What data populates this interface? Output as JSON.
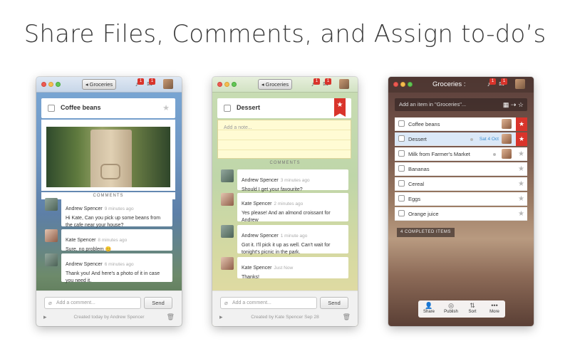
{
  "headline": "Share Files, Comments, and Assign to-do’s",
  "windows": [
    {
      "back_label": "◂ Groceries",
      "badges": [
        "1",
        "1"
      ],
      "detail": {
        "title": "Coffee beans"
      },
      "comments_label": "COMMENTS",
      "comments": [
        {
          "name": "Andrew Spencer",
          "time": "9 minutes ago",
          "text": "Hi Kate, Can you pick up some beans from the cafe near your house?"
        },
        {
          "name": "Kate Spencer",
          "time": "8 minutes ago",
          "text": "Sure, no problem 😊"
        },
        {
          "name": "Andrew Spencer",
          "time": "6 minutes ago",
          "text": "Thank you! And here's a photo of it in case you need it."
        }
      ],
      "add_comment_placeholder": "Add a comment...",
      "send_label": "Send",
      "created_text": "Created today by Andrew Spencer"
    },
    {
      "back_label": "◂ Groceries",
      "badges": [
        "1",
        "1"
      ],
      "detail": {
        "title": "Dessert",
        "note_placeholder": "Add a note..."
      },
      "comments_label": "COMMENTS",
      "comments": [
        {
          "name": "Andrew Spencer",
          "time": "3 minutes ago",
          "text": "Should I get your favourite?"
        },
        {
          "name": "Kate Spencer",
          "time": "2 minutes ago",
          "text": "Yes please! And an almond croissant for Andrew"
        },
        {
          "name": "Andrew Spencer",
          "time": "1 minute ago",
          "text": "Got it. I'll pick it up as well. Can't wait for tonight's picnic in the park."
        },
        {
          "name": "Kate Spencer",
          "time": "Just Now",
          "text": "Thanks!"
        }
      ],
      "add_comment_placeholder": "Add a comment...",
      "send_label": "Send",
      "created_text": "Created by Kate Spencer Sep 28"
    },
    {
      "title": "Groceries :",
      "badges": [
        "1",
        "1"
      ],
      "add_item_placeholder": "Add an item in \"Groceries\"...",
      "tasks": [
        {
          "title": "Coffee beans"
        },
        {
          "title": "Dessert",
          "date": "Sat 4 Oct"
        },
        {
          "title": "Milk from Farmer's Market"
        },
        {
          "title": "Bananas"
        },
        {
          "title": "Cereal"
        },
        {
          "title": "Eggs"
        },
        {
          "title": "Orange juice"
        }
      ],
      "completed_label": "4 COMPLETED ITEMS",
      "toolbar": [
        {
          "label": "Share",
          "icon": "share-icon"
        },
        {
          "label": "Publish",
          "icon": "publish-icon"
        },
        {
          "label": "Sort",
          "icon": "sort-icon"
        },
        {
          "label": "More",
          "icon": "more-icon"
        }
      ]
    }
  ],
  "colors": {
    "accent_red": "#d9342b",
    "date_blue": "#3b8ed0",
    "selected_row": "#dbe8f7"
  }
}
